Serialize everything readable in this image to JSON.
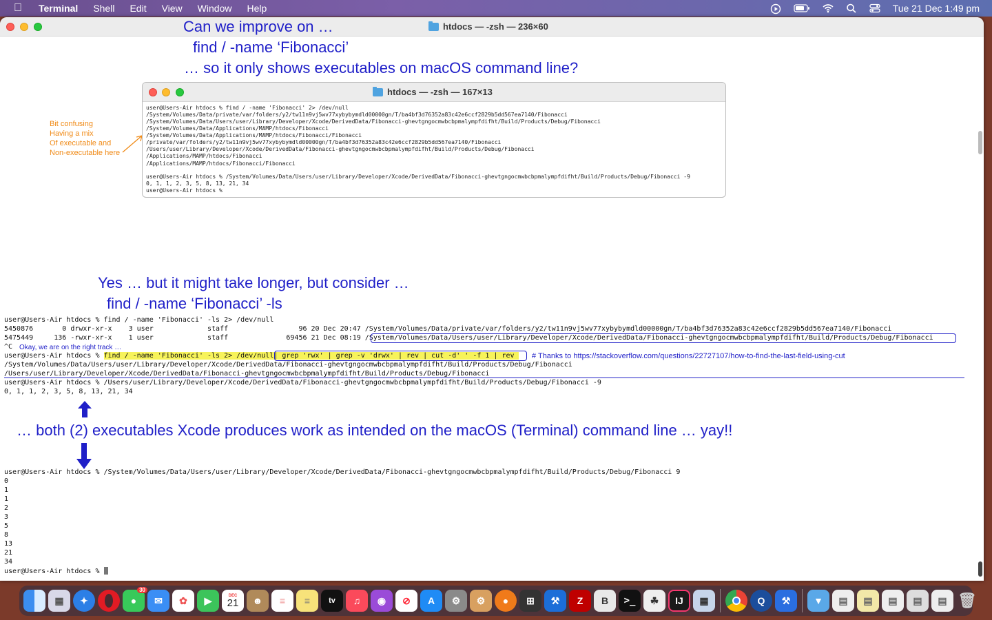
{
  "menubar": {
    "app_name": "Terminal",
    "items": [
      "Shell",
      "Edit",
      "View",
      "Window",
      "Help"
    ],
    "datetime": "Tue 21 Dec  1:49 pm"
  },
  "window": {
    "title": "htdocs — -zsh — 236×60"
  },
  "annotations": {
    "heading1": "Can we improve on …",
    "heading2": "find / -name ‘Fibonacci’",
    "heading3": "… so it only shows executables on macOS command line?",
    "yes1": "Yes … but it might take longer, but consider …",
    "yes2": "find / -name ‘Fibonacci’ -ls",
    "both": "… both (2) executables Xcode produces work as intended on the macOS (Terminal) command line … yay!!",
    "orange_note": [
      "Bit confusing",
      "Having a mix",
      "Of executable and",
      "Non-executable here"
    ],
    "okay_note": "Okay, we are on the right track …",
    "thanks_note": "# Thanks to https://stackoverflow.com/questions/22727107/how-to-find-the-last-field-using-cut"
  },
  "inner_window": {
    "title": "htdocs — -zsh — 167×13",
    "lines": [
      "user@Users-Air htdocs % find / -name 'Fibonacci' 2> /dev/null",
      "/System/Volumes/Data/private/var/folders/y2/tw11n9vj5wv77xybybymdld00000gn/T/ba4bf3d76352a83c42e6ccf2829b5dd567ea7140/Fibonacci",
      "/System/Volumes/Data/Users/user/Library/Developer/Xcode/DerivedData/Fibonacci-ghevtgngocmwbcbpmalympfdifht/Build/Products/Debug/Fibonacci",
      "/System/Volumes/Data/Applications/MAMP/htdocs/Fibonacci",
      "/System/Volumes/Data/Applications/MAMP/htdocs/Fibonacci/Fibonacci",
      "/private/var/folders/y2/tw11n9vj5wv77xybybymdld00000gn/T/ba4bf3d76352a83c42e6ccf2829b5dd567ea7140/Fibonacci",
      "/Users/user/Library/Developer/Xcode/DerivedData/Fibonacci-ghevtgngocmwbcbpmalympfdifht/Build/Products/Debug/Fibonacci",
      "/Applications/MAMP/htdocs/Fibonacci",
      "/Applications/MAMP/htdocs/Fibonacci/Fibonacci",
      "",
      "user@Users-Air htdocs % /System/Volumes/Data/Users/user/Library/Developer/Xcode/DerivedData/Fibonacci-ghevtgngocmwbcbpmalympfdifht/Build/Products/Debug/Fibonacci -9",
      "0, 1, 1, 2, 3, 5, 8, 13, 21, 34",
      "user@Users-Air htdocs % "
    ]
  },
  "terminal": {
    "ls_cmd": "user@Users-Air htdocs % find / -name 'Fibonacci' -ls 2> /dev/null",
    "ls_row1": "5450876       0 drwxr-xr-x    3 user             staff                 96 20 Dec 20:47 /System/Volumes/Data/private/var/folders/y2/tw11n9vj5wv77xybybymdld00000gn/T/ba4bf3d76352a83c42e6ccf2829b5dd567ea7140/Fibonacci",
    "ls_row2_prefix": "5475449     136 -rwxr-xr-x    1 user             staff              69456 21 Dec 08:19 ",
    "ls_row2_path": "/System/Volumes/Data/Users/user/Library/Developer/Xcode/DerivedData/Fibonacci-ghevtgngocmwbcbpmalympfdifht/Build/Products/Debug/Fibonacci",
    "ctrl_c": "^C",
    "prompt": "user@Users-Air htdocs % ",
    "grep_cmd_a": "find / -name 'Fibonacci' -ls 2> /dev/null",
    "grep_cmd_b": "| grep 'rwx' | grep -v 'drwx' | rev | cut -d' ' -f 1 | rev ",
    "grep_out1": "/System/Volumes/Data/Users/user/Library/Developer/Xcode/DerivedData/Fibonacci-ghevtgngocmwbcbpmalympfdifht/Build/Products/Debug/Fibonacci",
    "grep_out2": "/Users/user/Library/Developer/Xcode/DerivedData/Fibonacci-ghevtgngocmwbcbpmalympfdifht/Build/Products/Debug/Fibonacci",
    "run_cmd1": "user@Users-Air htdocs % /Users/user/Library/Developer/Xcode/DerivedData/Fibonacci-ghevtgngocmwbcbpmalympfdifht/Build/Products/Debug/Fibonacci -9",
    "run_out1": "0, 1, 1, 2, 3, 5, 8, 13, 21, 34",
    "run_cmd2": "user@Users-Air htdocs % /System/Volumes/Data/Users/user/Library/Developer/Xcode/DerivedData/Fibonacci-ghevtgngocmwbcbpmalympfdifht/Build/Products/Debug/Fibonacci 9",
    "run_out2": [
      "0",
      "1",
      "1",
      "2",
      "3",
      "5",
      "8",
      "13",
      "21",
      "34"
    ],
    "final_prompt": "user@Users-Air htdocs % "
  },
  "dock": {
    "calendar_day": "21",
    "calendar_month": "DEC",
    "tv_label": "tv",
    "badge_messages": "30"
  }
}
